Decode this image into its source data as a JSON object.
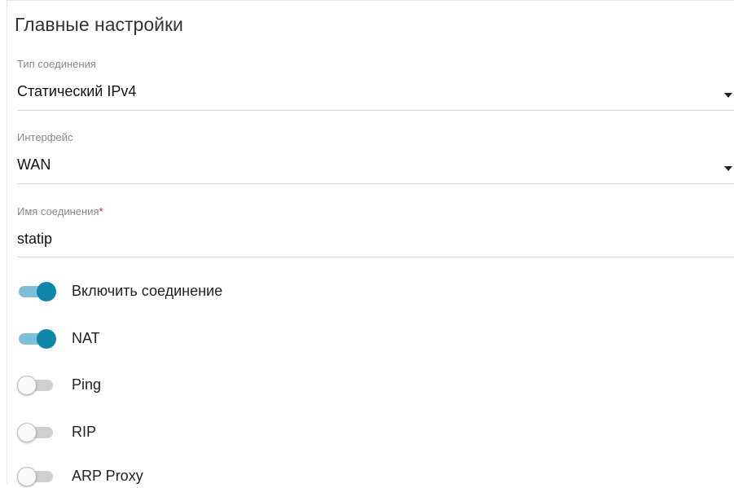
{
  "section": {
    "title": "Главные настройки"
  },
  "fields": {
    "connection_type": {
      "label": "Тип соединения",
      "value": "Статический IPv4"
    },
    "interface": {
      "label": "Интерфейс",
      "value": "WAN"
    },
    "connection_name": {
      "label": "Имя соединения",
      "required_mark": "*",
      "value": "statip"
    }
  },
  "toggles": [
    {
      "label": "Включить соединение",
      "state": "on"
    },
    {
      "label": "NAT",
      "state": "on"
    },
    {
      "label": "Ping",
      "state": "off"
    },
    {
      "label": "RIP",
      "state": "off"
    },
    {
      "label": "ARP Proxy",
      "state": "off"
    }
  ],
  "colors": {
    "toggle_on_knob": "#0f86ac",
    "toggle_on_track": "#7dbfd4",
    "toggle_off_track": "#cfcfcf",
    "required_star": "#e02020"
  }
}
